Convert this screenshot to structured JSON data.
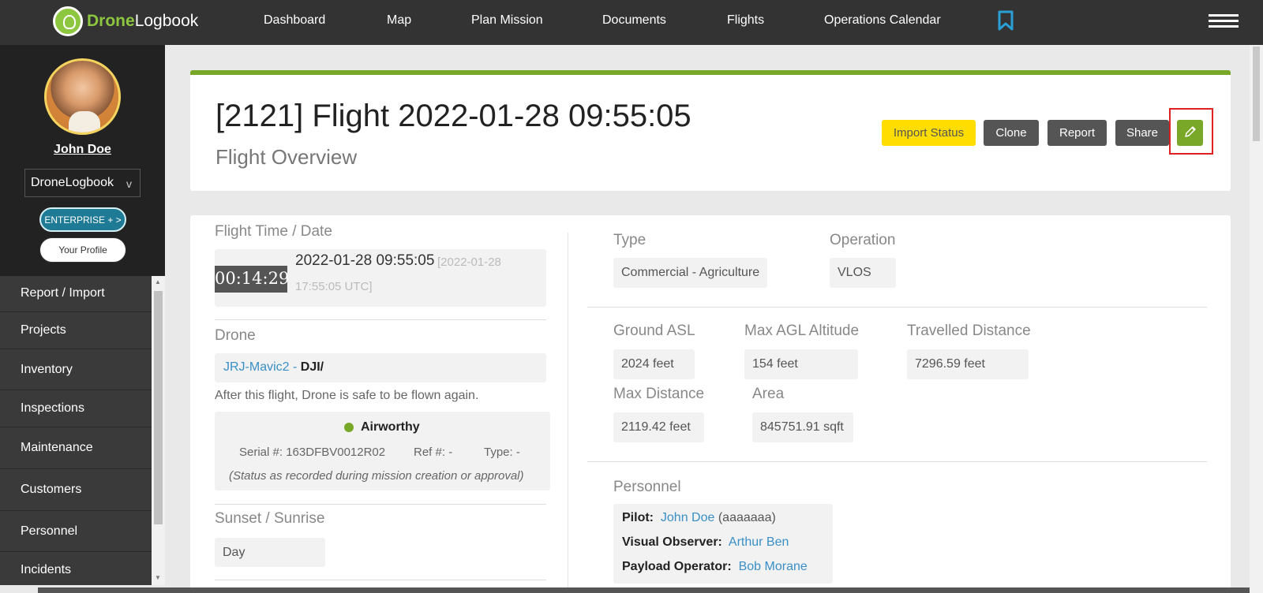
{
  "app": {
    "logo_text_accent": "Drone",
    "logo_text_rest": "Logbook",
    "brand_color": "#8dc63f"
  },
  "nav": {
    "items": [
      "Dashboard",
      "Map",
      "Plan Mission",
      "Documents",
      "Flights",
      "Operations Calendar"
    ],
    "bookmark_icon": "bookmark-icon",
    "menu_icon": "hamburger-icon"
  },
  "user": {
    "name": "John Doe",
    "org": "DroneLogbook",
    "org_chevron": "v",
    "enterprise_label": "ENTERPRISE + >",
    "profile_label": "Your Profile"
  },
  "sidebar": {
    "items": [
      "Report / Import",
      "Projects",
      "Inventory",
      "Inspections",
      "Maintenance",
      "Customers",
      "Personnel",
      "Incidents"
    ]
  },
  "header": {
    "title": "[2121] Flight 2022-01-28 09:55:05",
    "subtitle": "Flight Overview",
    "buttons": {
      "import_status": "Import Status",
      "clone": "Clone",
      "report": "Report",
      "share": "Share"
    },
    "edit_icon": "pencil-icon"
  },
  "flight": {
    "time_label": "Flight Time / Date",
    "duration": "00:14:29",
    "local_datetime": "2022-01-28 09:55:05",
    "utc_datetime": "[2022-01-28 17:55:05 UTC]",
    "drone_label": "Drone",
    "drone_name": "JRJ-Mavic2",
    "drone_sep": " - ",
    "drone_model": "DJI/",
    "drone_note": "After this flight, Drone is safe to be flown again.",
    "status": "Airworthy",
    "serial_label": "Serial #:",
    "serial": "163DFBV0012R02",
    "ref_label": "Ref #:",
    "ref": "-",
    "type_label": "Type:",
    "type": "-",
    "status_note": "(Status as recorded during mission creation or approval)",
    "sunset_label": "Sunset / Sunrise",
    "sunset_value": "Day"
  },
  "details": {
    "type_label": "Type",
    "type_value": "Commercial - Agriculture",
    "operation_label": "Operation",
    "operation_value": "VLOS",
    "ground_asl_label": "Ground ASL",
    "ground_asl_value": "2024 feet",
    "max_agl_label": "Max AGL Altitude",
    "max_agl_value": "154 feet",
    "travelled_label": "Travelled Distance",
    "travelled_value": "7296.59 feet",
    "max_distance_label": "Max Distance",
    "max_distance_value": "2119.42 feet",
    "area_label": "Area",
    "area_value": "845751.91 sqft"
  },
  "personnel": {
    "label": "Personnel",
    "pilot_label": "Pilot:",
    "pilot_name": "John Doe",
    "pilot_id": "(aaaaaaa)",
    "observer_label": "Visual Observer:",
    "observer_name": "Arthur Ben",
    "payload_label": "Payload Operator:",
    "payload_name": "Bob Morane"
  }
}
